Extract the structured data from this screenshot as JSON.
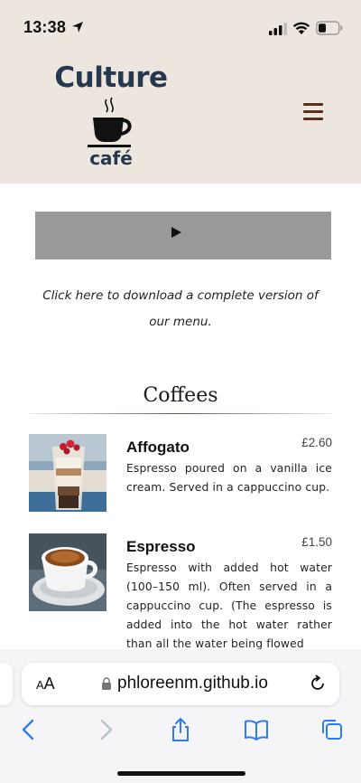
{
  "status": {
    "time": "13:38"
  },
  "site": {
    "logo_top": "Culture",
    "logo_bottom": "café"
  },
  "download_link": {
    "line1": "Click here to download a complete version of",
    "line2": "our menu."
  },
  "section": {
    "title": "Coffees"
  },
  "items": [
    {
      "name": "Affogato",
      "price": "£2.60",
      "description": "Espresso poured on a vanilla ice cream. Served in a cappuccino cup.",
      "image_icon": "affogato-photo"
    },
    {
      "name": "Espresso",
      "price": "£1.50",
      "description": "Espresso with added hot water (100–150 ml). Often served in a cappuccino cup. (The espresso is added into the hot water rather than all the water being flowed",
      "image_icon": "espresso-photo"
    }
  ],
  "browser": {
    "text_size_small": "A",
    "text_size_big": "A",
    "url": "phloreenm.github.io"
  },
  "colors": {
    "header_bg": "#ece6df",
    "logo": "#25384f",
    "menu_icon": "#5b2e20",
    "ios_blue": "#2f7bf5"
  }
}
